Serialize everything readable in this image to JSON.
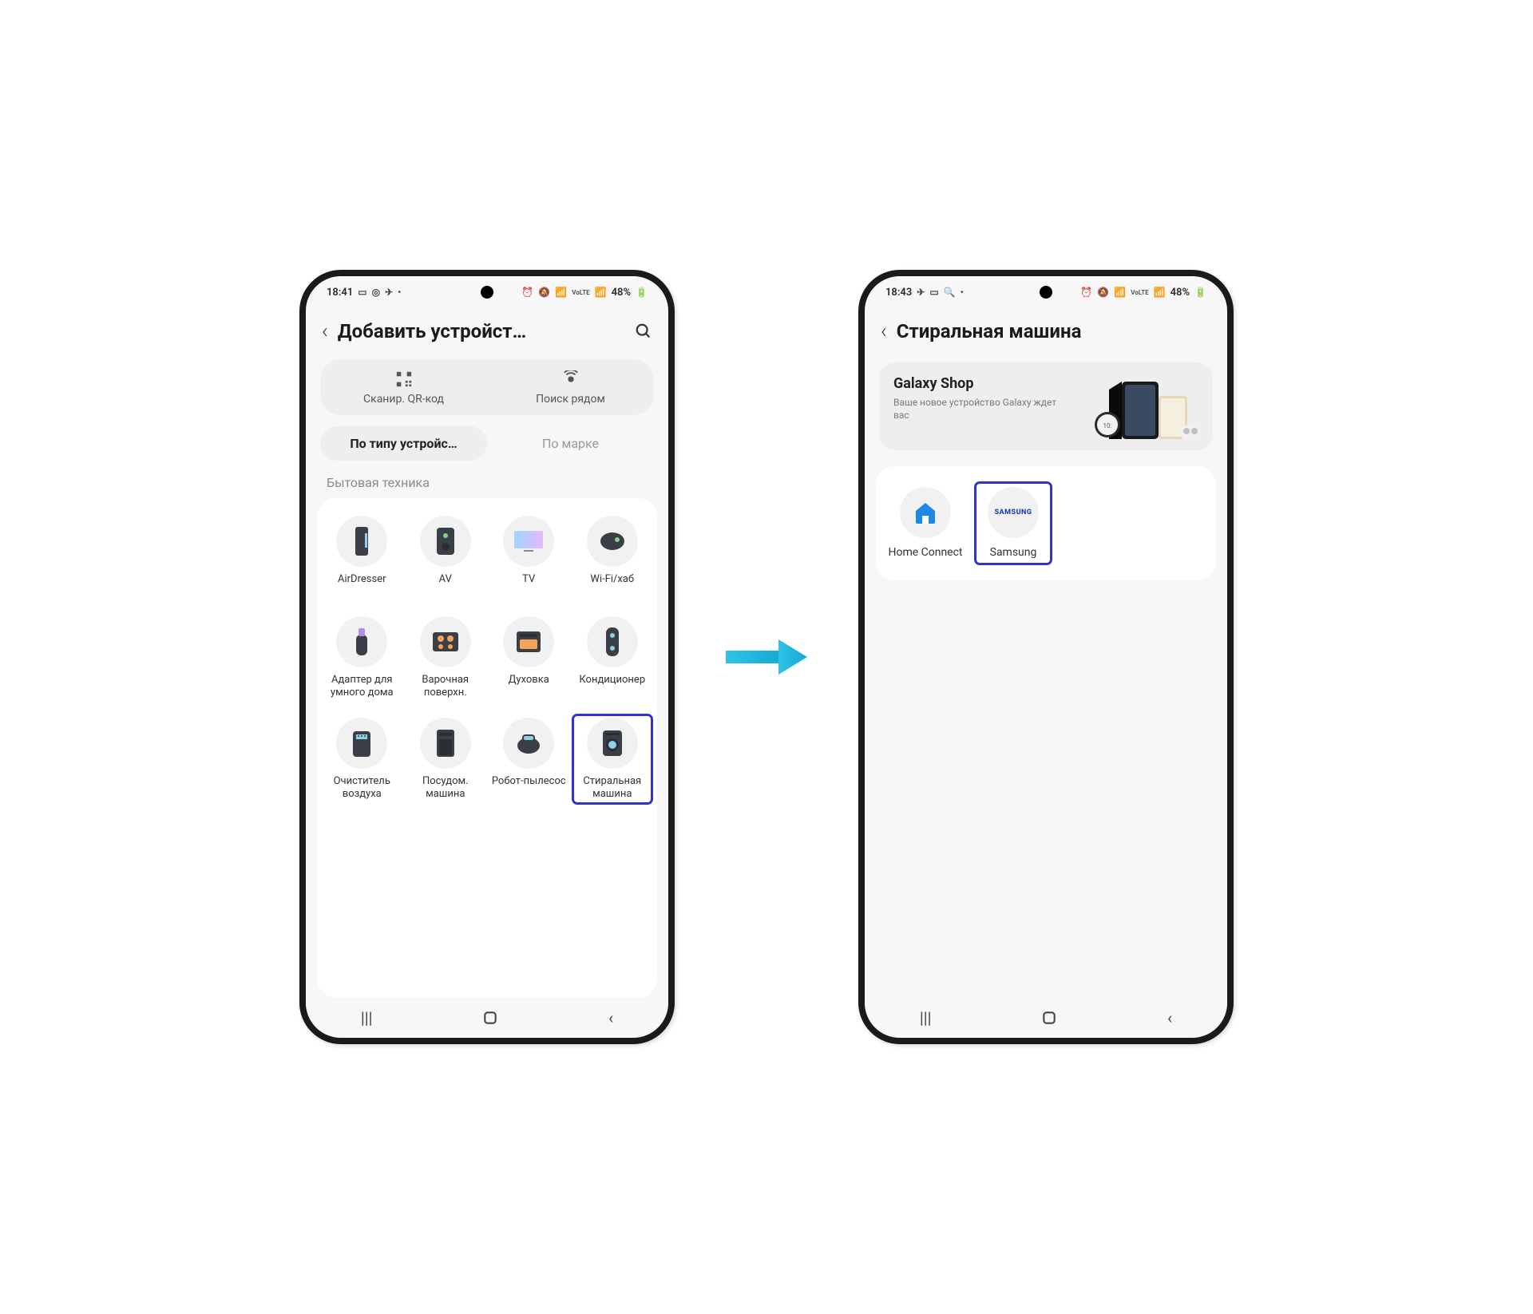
{
  "phone1": {
    "status": {
      "time": "18:41",
      "battery": "48%"
    },
    "header": {
      "title": "Добавить устройст…"
    },
    "quick": {
      "qr": "Сканир. QR-код",
      "near": "Поиск рядом"
    },
    "tabs": {
      "byType": "По типу устройс…",
      "byBrand": "По марке"
    },
    "sectionLabel": "Бытовая техника",
    "devices": [
      {
        "label": "AirDresser"
      },
      {
        "label": "AV"
      },
      {
        "label": "TV"
      },
      {
        "label": "Wi-Fi/хаб"
      },
      {
        "label": "Адаптер для умного дома"
      },
      {
        "label": "Варочная поверхн."
      },
      {
        "label": "Духовка"
      },
      {
        "label": "Кондиционер"
      },
      {
        "label": "Очиститель воздуха"
      },
      {
        "label": "Посудом. машина"
      },
      {
        "label": "Робот-пылесос"
      },
      {
        "label": "Стиральная машина"
      }
    ]
  },
  "phone2": {
    "status": {
      "time": "18:43",
      "battery": "48%"
    },
    "header": {
      "title": "Стиральная машина"
    },
    "banner": {
      "title": "Galaxy Shop",
      "subtitle": "Ваше новое устройство Galaxy ждет вас"
    },
    "brands": [
      {
        "label": "Home Connect"
      },
      {
        "label": "Samsung"
      }
    ]
  }
}
